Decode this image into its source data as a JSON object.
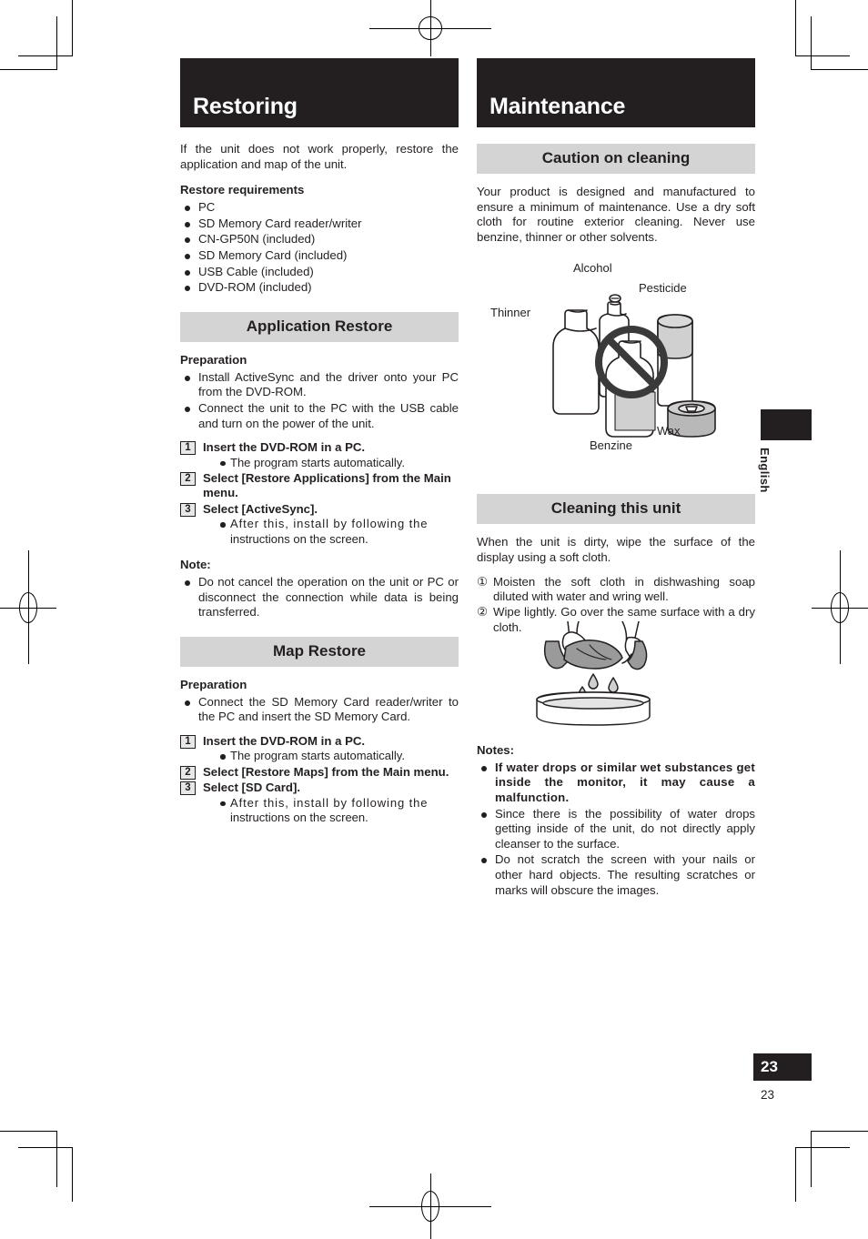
{
  "page": {
    "number_badge": "23",
    "number_plain": "23",
    "language_tab": "English",
    "colors": {
      "banner": "#231f20",
      "section_bar": "#d4d4d4",
      "text": "#231f20"
    }
  },
  "left_column": {
    "banner_title": "Restoring",
    "intro": "If the unit does not work properly, restore the application and map of the unit.",
    "requirements_heading": "Restore requirements",
    "requirements": [
      "PC",
      "SD Memory Card reader/writer",
      "CN-GP50N (included)",
      "SD Memory Card (included)",
      "USB Cable (included)",
      "DVD-ROM (included)"
    ],
    "application_restore": {
      "bar_title": "Application Restore",
      "preparation_heading": "Preparation",
      "preparation": [
        "Install ActiveSync and the driver onto your PC from the DVD-ROM.",
        "Connect the unit to the PC with the USB cable and turn on the power of the unit."
      ],
      "steps": [
        {
          "num": "1",
          "text": "Insert the DVD-ROM in a PC.",
          "sub": "The program starts automatically."
        },
        {
          "num": "2",
          "text": "Select [Restore Applications] from the Main menu.",
          "sub": ""
        },
        {
          "num": "3",
          "text": "Select [ActiveSync].",
          "sub_wide": "After this, install by following the",
          "sub_cont": "instructions on the screen."
        }
      ],
      "note_heading": "Note:",
      "notes": [
        "Do not cancel the operation on the unit or PC or disconnect the connection while data is being transferred."
      ]
    },
    "map_restore": {
      "bar_title": "Map Restore",
      "preparation_heading": "Preparation",
      "preparation": [
        "Connect the SD Memory Card reader/writer to the PC and insert the SD Memory Card."
      ],
      "steps": [
        {
          "num": "1",
          "text": "Insert the DVD-ROM in a PC.",
          "sub": "The program starts automatically."
        },
        {
          "num": "2",
          "text": "Select [Restore Maps] from the Main menu.",
          "sub": ""
        },
        {
          "num": "3",
          "text": "Select [SD Card].",
          "sub_wide": "After this, install by following the",
          "sub_cont": "instructions on the screen."
        }
      ]
    }
  },
  "right_column": {
    "banner_title": "Maintenance",
    "caution": {
      "bar_title": "Caution on cleaning",
      "body": "Your product is designed and manufactured to ensure a minimum of maintenance. Use a dry soft cloth for routine exterior cleaning. Never use benzine, thinner or other solvents."
    },
    "solvent_figure": {
      "labels": {
        "thinner": "Thinner",
        "alcohol": "Alcohol",
        "pesticide": "Pesticide",
        "wax": "Wax",
        "benzine": "Benzine"
      },
      "prohibition_symbol": "no-entry-icon"
    },
    "cleaning": {
      "bar_title": "Cleaning this unit",
      "body": "When the unit is dirty, wipe the surface of the display using a soft cloth.",
      "steps": [
        {
          "marker": "①",
          "text": "Moisten the soft cloth in dishwashing soap diluted with water and wring well."
        },
        {
          "marker": "②",
          "text": "Wipe lightly. Go over the same surface with a dry cloth."
        }
      ]
    },
    "cloth_figure": {
      "description": "hands-wringing-cloth-over-basin"
    },
    "notes_heading": "Notes:",
    "notes": [
      {
        "text": "If water drops or similar wet substances get inside the monitor, it may cause a malfunction.",
        "bold": true
      },
      {
        "text": "Since there is the possibility of water drops getting inside of the unit, do not directly apply cleanser to the surface.",
        "bold": false
      },
      {
        "text": "Do not scratch the screen with your nails or other hard objects. The resulting scratches or marks will obscure the images.",
        "bold": false
      }
    ]
  }
}
